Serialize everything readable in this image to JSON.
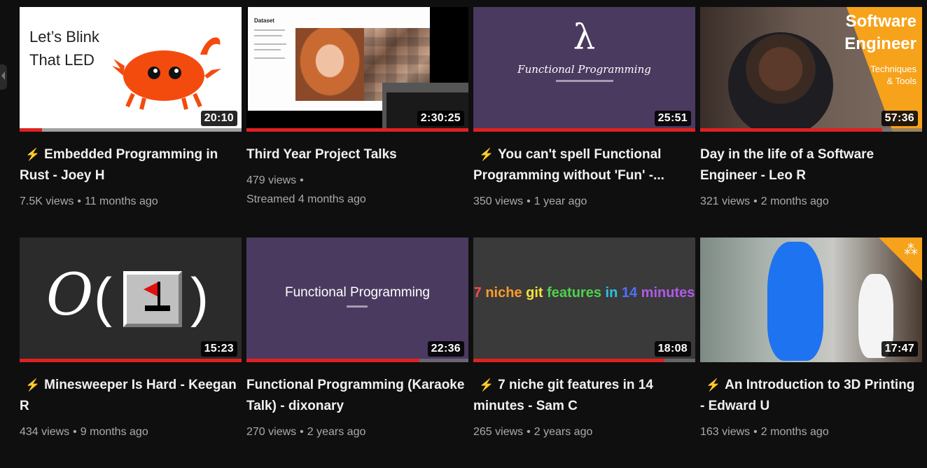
{
  "videos": [
    {
      "title": "Embedded Programming in Rust - Joey H",
      "bolt": true,
      "duration": "20:10",
      "progress": 0.1,
      "views": "7.5K views",
      "sep": "•",
      "age": "11 months ago",
      "thumb_text": [
        "Let’s Blink",
        "That LED"
      ]
    },
    {
      "title": "Third Year Project Talks",
      "bolt": false,
      "duration": "2:30:25",
      "progress": 1.0,
      "views": "479 views",
      "sep": "•",
      "age": "Streamed 4 months ago",
      "thumb_text": [
        "Dataset"
      ]
    },
    {
      "title": "You can't spell Functional Programming without 'Fun' -...",
      "bolt": true,
      "duration": "25:51",
      "progress": 1.0,
      "views": "350 views",
      "sep": "•",
      "age": "1 year ago",
      "thumb_text": [
        "λ",
        "Functional Programming"
      ]
    },
    {
      "title": "Day in the life of a Software Engineer - Leo R",
      "bolt": false,
      "duration": "57:36",
      "progress": 0.82,
      "views": "321 views",
      "sep": "•",
      "age": "2 months ago",
      "thumb_text": [
        "Software",
        "Engineer",
        "Techniques",
        "& Tools"
      ]
    },
    {
      "title": "Minesweeper Is Hard - Keegan R",
      "bolt": true,
      "duration": "15:23",
      "progress": 1.0,
      "views": "434 views",
      "sep": "•",
      "age": "9 months ago",
      "thumb_text": [
        "O",
        "(",
        ")"
      ]
    },
    {
      "title": "Functional Programming (Karaoke Talk) - dixonary",
      "bolt": false,
      "duration": "22:36",
      "progress": 0.78,
      "views": "270 views",
      "sep": "•",
      "age": "2 years ago",
      "thumb_text": [
        "Functional Programming"
      ]
    },
    {
      "title": "7 niche git features in 14 minutes - Sam C",
      "bolt": true,
      "duration": "18:08",
      "progress": 0.86,
      "views": "265 views",
      "sep": "•",
      "age": "2 years ago",
      "thumb_text": [
        "7",
        "niche",
        "git",
        "features",
        "in",
        "14",
        "minutes"
      ]
    },
    {
      "title": "An Introduction to 3D Printing - Edward U",
      "bolt": true,
      "duration": "17:47",
      "progress": 0.0,
      "views": "163 views",
      "sep": "•",
      "age": "2 months ago",
      "thumb_text": []
    }
  ],
  "icons": {
    "bolt": "lightning-bolt-icon",
    "bolt_glyph": "⚡",
    "network": "network-icon",
    "network_glyph": "⁂"
  },
  "colors": {
    "background": "#0f0f0f",
    "progress": "#e02020",
    "bolt": "#e8672a",
    "meta": "#aaaaaa",
    "accent_orange": "#f7a21b",
    "slide_purple": "#4a3a5f"
  }
}
